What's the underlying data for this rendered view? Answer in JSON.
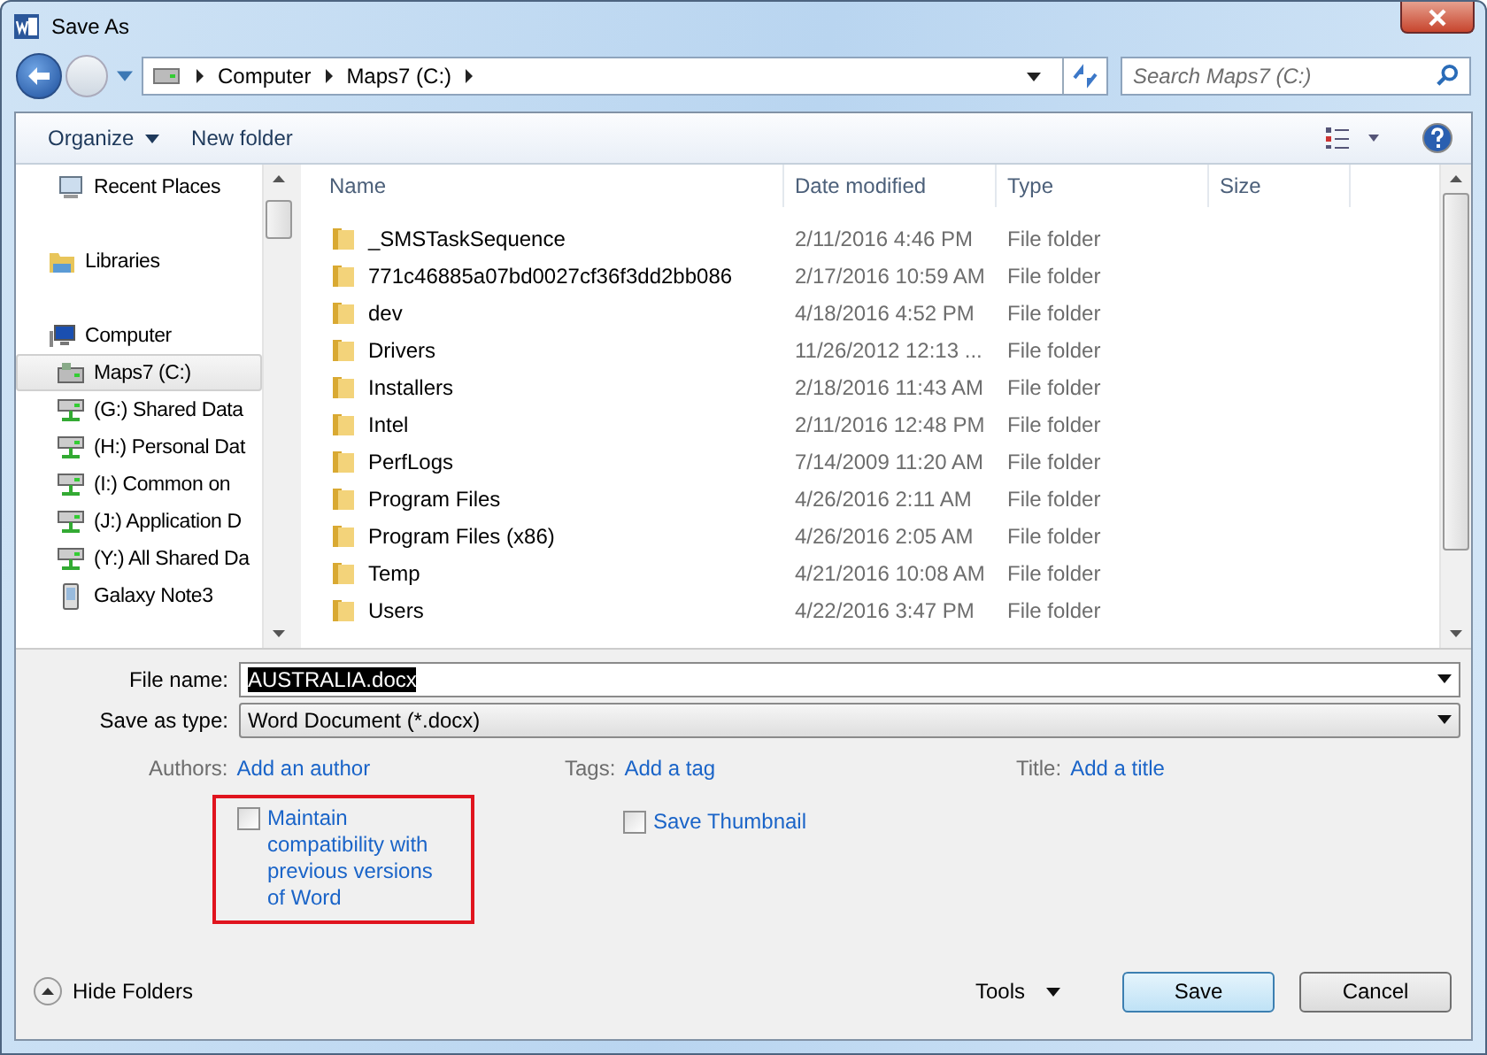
{
  "window": {
    "title": "Save As"
  },
  "address": {
    "crumbs": [
      "Computer",
      "Maps7 (C:)"
    ]
  },
  "search": {
    "placeholder": "Search Maps7 (C:)"
  },
  "toolbar": {
    "organize": "Organize",
    "new_folder": "New folder"
  },
  "sidebar": {
    "favorites": [
      {
        "label": "Recent Places",
        "kind": "recent",
        "selected": false
      }
    ],
    "items": [
      {
        "label": "Libraries",
        "kind": "library",
        "selected": false
      },
      {
        "label": "Computer",
        "kind": "computer",
        "selected": false,
        "children": [
          {
            "label": "Maps7 (C:)",
            "kind": "drive",
            "selected": true
          },
          {
            "label": "(G:) Shared Data",
            "kind": "network",
            "selected": false
          },
          {
            "label": "(H:) Personal Dat",
            "kind": "network",
            "selected": false
          },
          {
            "label": "(I:) Common on",
            "kind": "network",
            "selected": false
          },
          {
            "label": "(J:) Application D",
            "kind": "network",
            "selected": false
          },
          {
            "label": "(Y:) All Shared Da",
            "kind": "network",
            "selected": false
          },
          {
            "label": "Galaxy Note3",
            "kind": "phone",
            "selected": false
          }
        ]
      }
    ]
  },
  "files": {
    "columns": [
      "Name",
      "Date modified",
      "Type",
      "Size"
    ],
    "rows": [
      {
        "name": "_SMSTaskSequence",
        "date": "2/11/2016 4:46 PM",
        "type": "File folder"
      },
      {
        "name": "771c46885a07bd0027cf36f3dd2bb086",
        "date": "2/17/2016 10:59 AM",
        "type": "File folder"
      },
      {
        "name": "dev",
        "date": "4/18/2016 4:52 PM",
        "type": "File folder"
      },
      {
        "name": "Drivers",
        "date": "11/26/2012 12:13 ...",
        "type": "File folder"
      },
      {
        "name": "Installers",
        "date": "2/18/2016 11:43 AM",
        "type": "File folder"
      },
      {
        "name": "Intel",
        "date": "2/11/2016 12:48 PM",
        "type": "File folder"
      },
      {
        "name": "PerfLogs",
        "date": "7/14/2009 11:20 AM",
        "type": "File folder"
      },
      {
        "name": "Program Files",
        "date": "4/26/2016 2:11 AM",
        "type": "File folder"
      },
      {
        "name": "Program Files (x86)",
        "date": "4/26/2016 2:05 AM",
        "type": "File folder"
      },
      {
        "name": "Temp",
        "date": "4/21/2016 10:08 AM",
        "type": "File folder"
      },
      {
        "name": "Users",
        "date": "4/22/2016 3:47 PM",
        "type": "File folder"
      }
    ]
  },
  "file_name": {
    "label": "File name:",
    "value": "AUSTRALIA.docx"
  },
  "save_type": {
    "label": "Save as type:",
    "value": "Word Document (*.docx)"
  },
  "metadata": [
    {
      "label": "Authors:",
      "value": "Add an author"
    },
    {
      "label": "Tags:",
      "value": "Add a tag"
    },
    {
      "label": "Title:",
      "value": "Add a title"
    }
  ],
  "options": [
    {
      "label": "Maintain compatibility with previous versions of Word",
      "checked": false,
      "highlighted": true
    },
    {
      "label": "Save Thumbnail",
      "checked": false,
      "highlighted": false
    }
  ],
  "footer": {
    "hide_folders": "Hide Folders",
    "tools": "Tools",
    "buttons": [
      {
        "label": "Save",
        "kind": "primary"
      },
      {
        "label": "Cancel",
        "kind": "normal"
      }
    ]
  }
}
